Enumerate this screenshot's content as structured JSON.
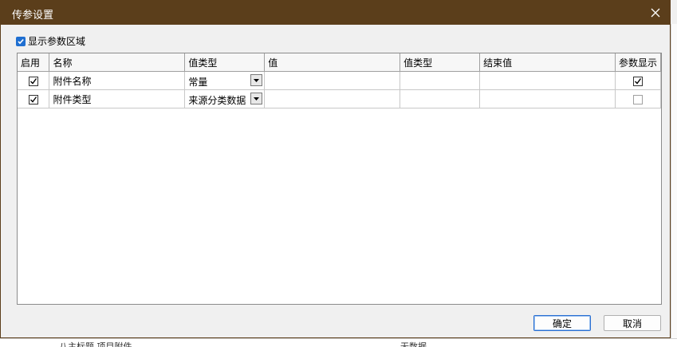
{
  "dialog": {
    "title": "传参设置"
  },
  "show_params_area": {
    "label": "显示参数区域",
    "checked": true
  },
  "grid": {
    "columns": [
      "启用",
      "名称",
      "值类型",
      "值",
      "值类型",
      "结束值",
      "参数显示"
    ],
    "rows": [
      {
        "enabled": true,
        "name": "附件名称",
        "value_type": "常量",
        "value": "",
        "value_type2": "",
        "end_value": "",
        "param_display": true
      },
      {
        "enabled": true,
        "name": "附件类型",
        "value_type": "来源分类数据",
        "value": "",
        "value_type2": "",
        "end_value": "",
        "param_display": false
      }
    ]
  },
  "buttons": {
    "ok": "确定",
    "cancel": "取消"
  },
  "background": {
    "left_text": "八主标题 项目附件",
    "right_text": "无数据"
  },
  "colors": {
    "titlebar": "#5b3e1b",
    "accent": "#1f6fd1"
  }
}
